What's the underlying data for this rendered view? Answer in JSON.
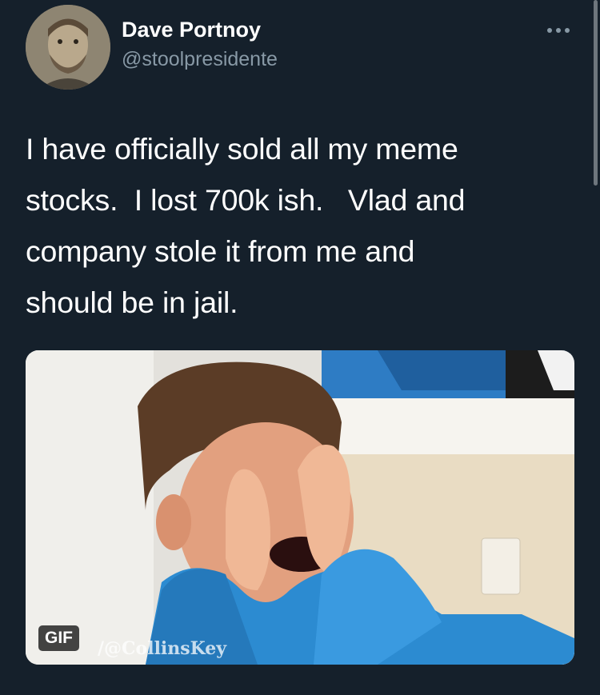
{
  "tweet": {
    "author": {
      "display_name": "Dave Portnoy",
      "handle": "@stoolpresidente",
      "avatar_icon": "profile-photo"
    },
    "more_icon": "more-dots-icon",
    "text": "I have officially sold all my meme\nstocks.  I lost 700k ish.   Vlad and\ncompany stole it from me and\nshould be in jail.",
    "media": {
      "type": "gif",
      "badge": "GIF",
      "watermark": "/@CollinsKey"
    }
  },
  "theme": {
    "background": "#15202b",
    "text_primary": "#ffffff",
    "text_secondary": "#8899a6"
  }
}
